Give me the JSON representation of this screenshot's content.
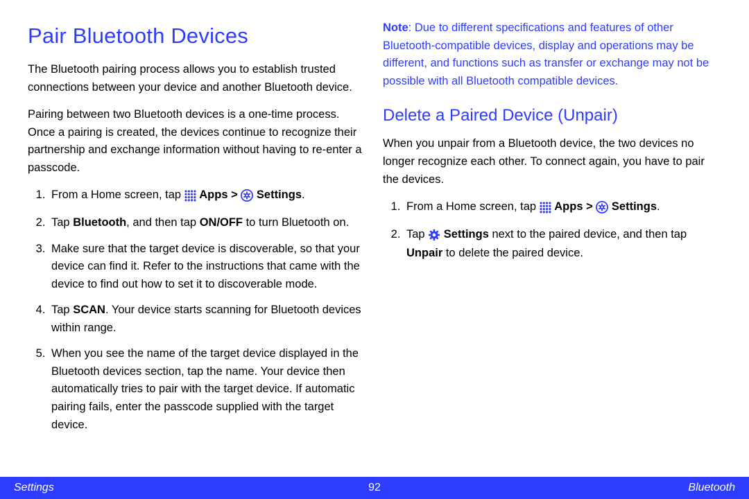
{
  "left": {
    "heading": "Pair Bluetooth Devices",
    "p1": "The Bluetooth pairing process allows you to establish trusted connections between your device and another Bluetooth device.",
    "p2": "Pairing between two Bluetooth devices is a one-time process. Once a pairing is created, the devices continue to recognize their partnership and exchange information without having to re-enter a passcode.",
    "step1_a": "From a Home screen, tap ",
    "step1_apps": "Apps",
    "step1_gt": " > ",
    "step1_settings": "Settings",
    "step1_end": ".",
    "step2_a": "Tap ",
    "step2_bt": "Bluetooth",
    "step2_b": ", and then tap ",
    "step2_onoff": "ON/OFF",
    "step2_c": " to turn Bluetooth on.",
    "step3": "Make sure that the target device is discoverable, so that your device can find it. Refer to the instructions that came with the device to find out how to set it to discoverable mode.",
    "step4_a": "Tap ",
    "step4_scan": "SCAN",
    "step4_b": ". Your device starts scanning for Bluetooth devices within range.",
    "step5": "When you see the name of the target device displayed in the Bluetooth devices section, tap the name. Your device then automatically tries to pair with the target device. If automatic pairing fails, enter the passcode supplied with the target device."
  },
  "right": {
    "note_label": "Note",
    "note_body": ": Due to different specifications and features of other Bluetooth-compatible devices, display and operations may be different, and functions such as transfer or exchange may not be possible with all Bluetooth compatible devices.",
    "heading2": "Delete a Paired Device (Unpair)",
    "p1": "When you unpair from a Bluetooth device, the two devices no longer recognize each other. To connect again, you have to pair the devices.",
    "step1_a": "From a Home screen, tap ",
    "step1_apps": "Apps",
    "step1_gt": " > ",
    "step1_settings": "Settings",
    "step1_end": ".",
    "step2_a": "Tap ",
    "step2_settings": "Settings",
    "step2_b": " next to the paired device, and then tap ",
    "step2_unpair": "Unpair",
    "step2_c": " to delete the paired device."
  },
  "footer": {
    "left": "Settings",
    "center": "92",
    "right": "Bluetooth"
  }
}
